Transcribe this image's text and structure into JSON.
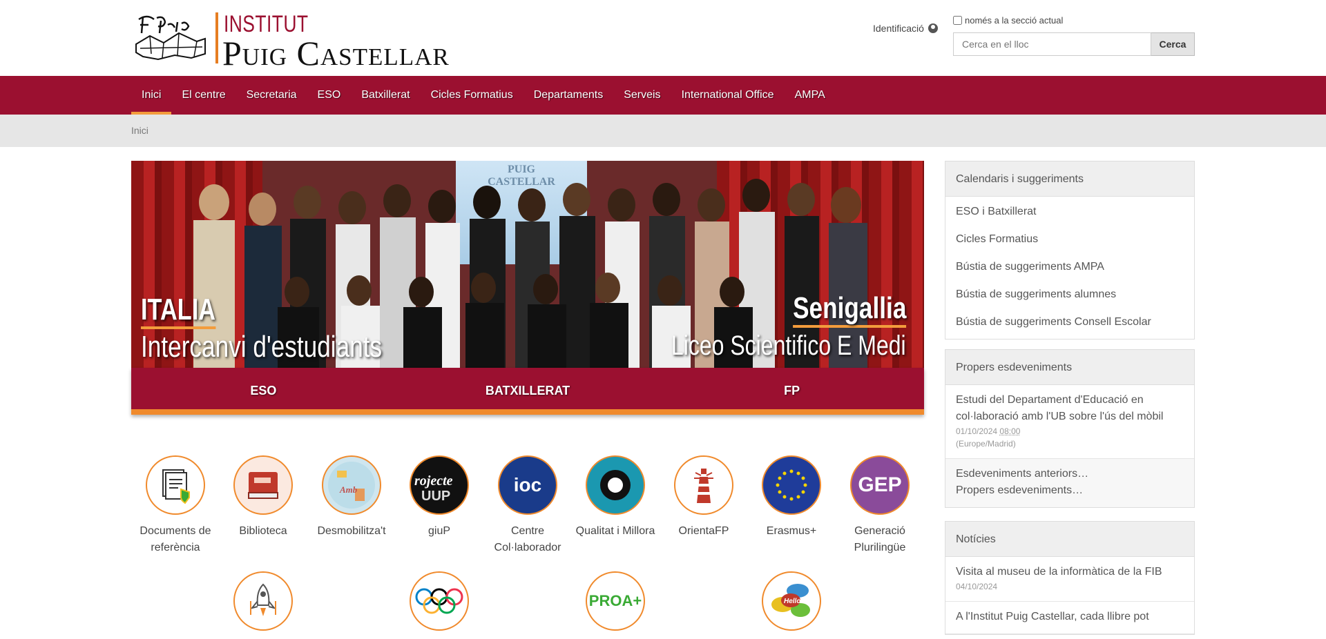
{
  "header": {
    "logo_institut": "INSTITUT",
    "logo_name": "Puig Castellar",
    "identification": "Identificació",
    "search_checkbox_label": "només a la secció actual",
    "search_placeholder": "Cerca en el lloc",
    "search_button": "Cerca"
  },
  "nav": {
    "items": [
      "Inici",
      "El centre",
      "Secretaria",
      "ESO",
      "Batxillerat",
      "Cicles Formatius",
      "Departaments",
      "Serveis",
      "International Office",
      "AMPA"
    ]
  },
  "breadcrumb": {
    "current": "Inici"
  },
  "banner": {
    "screen_text": "PUIG\nCASTELLAR",
    "left_title": "ITALIA",
    "left_subtitle": "Intercanvi d'estudiants",
    "right_title": "Senigallia",
    "right_subtitle": "Liceo Scientifico E Medi"
  },
  "levels": [
    "ESO",
    "BATXILLERAT",
    "FP"
  ],
  "tiles": [
    {
      "label": "Documents de referència",
      "icon": "documents-icon"
    },
    {
      "label": "Biblioteca",
      "icon": "book-icon"
    },
    {
      "label": "Desmobilitza't",
      "icon": "desmobilitza-icon"
    },
    {
      "label": "giuP",
      "icon": "giup-icon"
    },
    {
      "label": "Centre Col·laborador",
      "icon": "ioc-icon",
      "text": "ioc"
    },
    {
      "label": "Qualitat i Millora",
      "icon": "quality-icon"
    },
    {
      "label": "OrientaFP",
      "icon": "lighthouse-icon"
    },
    {
      "label": "Erasmus+",
      "icon": "eu-flag-icon"
    },
    {
      "label": "Generació Plurilingüe",
      "icon": "gep-icon",
      "text": "GEP"
    },
    {
      "label": "",
      "icon": "rocket-icon"
    },
    {
      "label": "",
      "icon": "olympic-rings-icon"
    },
    {
      "label": "",
      "icon": "proa-icon",
      "text": "PROA+"
    },
    {
      "label": "",
      "icon": "speech-bubbles-icon",
      "text": "Hello!"
    }
  ],
  "sidebar": {
    "calendars": {
      "title": "Calendaris i suggeriments",
      "items": [
        "ESO i Batxillerat",
        "Cicles Formatius",
        "Bústia de suggeriments AMPA",
        "Bústia de suggeriments alumnes",
        "Bústia de suggeriments Consell Escolar"
      ]
    },
    "events": {
      "title": "Propers esdeveniments",
      "item_title": "Estudi del Departament d'Educació en col·laboració amb l'UB sobre l'ús del mòbil",
      "item_date": "01/10/2024",
      "item_time": "08:00",
      "item_tz": "(Europe/Madrid)",
      "previous": "Esdeveniments anteriors…",
      "upcoming": "Propers esdeveniments…"
    },
    "news": {
      "title": "Notícies",
      "item1_title": "Visita al museu de la informàtica de la FIB",
      "item1_date": "04/10/2024",
      "item2_title": "A l'Institut Puig Castellar, cada llibre pot"
    }
  },
  "colors": {
    "brand": "#9b1030",
    "accent": "#f08a2c"
  }
}
